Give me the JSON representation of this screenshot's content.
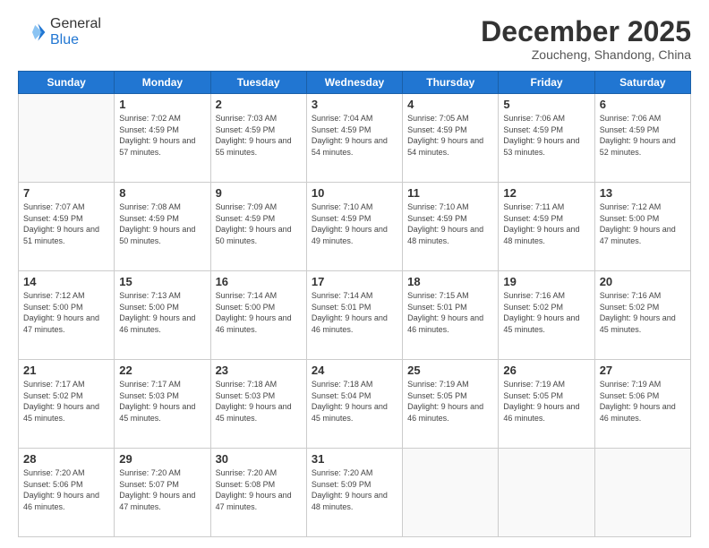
{
  "header": {
    "logo_line1": "General",
    "logo_line2": "Blue",
    "month": "December 2025",
    "location": "Zoucheng, Shandong, China"
  },
  "weekdays": [
    "Sunday",
    "Monday",
    "Tuesday",
    "Wednesday",
    "Thursday",
    "Friday",
    "Saturday"
  ],
  "weeks": [
    [
      {
        "day": null
      },
      {
        "day": "1",
        "sunrise": "7:02 AM",
        "sunset": "4:59 PM",
        "daylight": "9 hours and 57 minutes."
      },
      {
        "day": "2",
        "sunrise": "7:03 AM",
        "sunset": "4:59 PM",
        "daylight": "9 hours and 55 minutes."
      },
      {
        "day": "3",
        "sunrise": "7:04 AM",
        "sunset": "4:59 PM",
        "daylight": "9 hours and 54 minutes."
      },
      {
        "day": "4",
        "sunrise": "7:05 AM",
        "sunset": "4:59 PM",
        "daylight": "9 hours and 54 minutes."
      },
      {
        "day": "5",
        "sunrise": "7:06 AM",
        "sunset": "4:59 PM",
        "daylight": "9 hours and 53 minutes."
      },
      {
        "day": "6",
        "sunrise": "7:06 AM",
        "sunset": "4:59 PM",
        "daylight": "9 hours and 52 minutes."
      }
    ],
    [
      {
        "day": "7",
        "sunrise": "7:07 AM",
        "sunset": "4:59 PM",
        "daylight": "9 hours and 51 minutes."
      },
      {
        "day": "8",
        "sunrise": "7:08 AM",
        "sunset": "4:59 PM",
        "daylight": "9 hours and 50 minutes."
      },
      {
        "day": "9",
        "sunrise": "7:09 AM",
        "sunset": "4:59 PM",
        "daylight": "9 hours and 50 minutes."
      },
      {
        "day": "10",
        "sunrise": "7:10 AM",
        "sunset": "4:59 PM",
        "daylight": "9 hours and 49 minutes."
      },
      {
        "day": "11",
        "sunrise": "7:10 AM",
        "sunset": "4:59 PM",
        "daylight": "9 hours and 48 minutes."
      },
      {
        "day": "12",
        "sunrise": "7:11 AM",
        "sunset": "4:59 PM",
        "daylight": "9 hours and 48 minutes."
      },
      {
        "day": "13",
        "sunrise": "7:12 AM",
        "sunset": "5:00 PM",
        "daylight": "9 hours and 47 minutes."
      }
    ],
    [
      {
        "day": "14",
        "sunrise": "7:12 AM",
        "sunset": "5:00 PM",
        "daylight": "9 hours and 47 minutes."
      },
      {
        "day": "15",
        "sunrise": "7:13 AM",
        "sunset": "5:00 PM",
        "daylight": "9 hours and 46 minutes."
      },
      {
        "day": "16",
        "sunrise": "7:14 AM",
        "sunset": "5:00 PM",
        "daylight": "9 hours and 46 minutes."
      },
      {
        "day": "17",
        "sunrise": "7:14 AM",
        "sunset": "5:01 PM",
        "daylight": "9 hours and 46 minutes."
      },
      {
        "day": "18",
        "sunrise": "7:15 AM",
        "sunset": "5:01 PM",
        "daylight": "9 hours and 46 minutes."
      },
      {
        "day": "19",
        "sunrise": "7:16 AM",
        "sunset": "5:02 PM",
        "daylight": "9 hours and 45 minutes."
      },
      {
        "day": "20",
        "sunrise": "7:16 AM",
        "sunset": "5:02 PM",
        "daylight": "9 hours and 45 minutes."
      }
    ],
    [
      {
        "day": "21",
        "sunrise": "7:17 AM",
        "sunset": "5:02 PM",
        "daylight": "9 hours and 45 minutes."
      },
      {
        "day": "22",
        "sunrise": "7:17 AM",
        "sunset": "5:03 PM",
        "daylight": "9 hours and 45 minutes."
      },
      {
        "day": "23",
        "sunrise": "7:18 AM",
        "sunset": "5:03 PM",
        "daylight": "9 hours and 45 minutes."
      },
      {
        "day": "24",
        "sunrise": "7:18 AM",
        "sunset": "5:04 PM",
        "daylight": "9 hours and 45 minutes."
      },
      {
        "day": "25",
        "sunrise": "7:19 AM",
        "sunset": "5:05 PM",
        "daylight": "9 hours and 46 minutes."
      },
      {
        "day": "26",
        "sunrise": "7:19 AM",
        "sunset": "5:05 PM",
        "daylight": "9 hours and 46 minutes."
      },
      {
        "day": "27",
        "sunrise": "7:19 AM",
        "sunset": "5:06 PM",
        "daylight": "9 hours and 46 minutes."
      }
    ],
    [
      {
        "day": "28",
        "sunrise": "7:20 AM",
        "sunset": "5:06 PM",
        "daylight": "9 hours and 46 minutes."
      },
      {
        "day": "29",
        "sunrise": "7:20 AM",
        "sunset": "5:07 PM",
        "daylight": "9 hours and 47 minutes."
      },
      {
        "day": "30",
        "sunrise": "7:20 AM",
        "sunset": "5:08 PM",
        "daylight": "9 hours and 47 minutes."
      },
      {
        "day": "31",
        "sunrise": "7:20 AM",
        "sunset": "5:09 PM",
        "daylight": "9 hours and 48 minutes."
      },
      {
        "day": null
      },
      {
        "day": null
      },
      {
        "day": null
      }
    ]
  ]
}
